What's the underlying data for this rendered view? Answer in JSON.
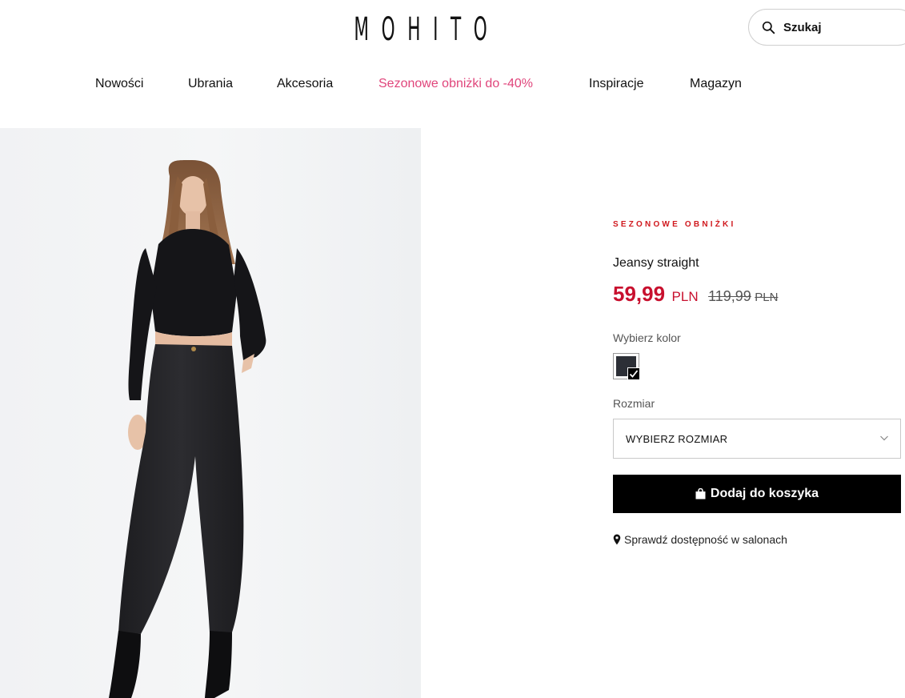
{
  "header": {
    "logo": "MOHITO",
    "search": {
      "placeholder": "Szukaj",
      "icon": "search-icon"
    }
  },
  "nav": {
    "items": [
      {
        "label": "Nowości"
      },
      {
        "label": "Ubrania"
      },
      {
        "label": "Akcesoria"
      },
      {
        "label": "Sezonowe obniżki do -40%",
        "highlight_color": "#e0457b"
      },
      {
        "label": "Inspiracje"
      },
      {
        "label": "Magazyn"
      }
    ]
  },
  "product": {
    "tag": "SEZONOWE OBNIŻKI",
    "name": "Jeansy straight",
    "price_now": "59,99",
    "currency_now": "PLN",
    "price_old": "119,99",
    "currency_old": "PLN",
    "color_label": "Wybierz kolor",
    "selected_color": "#2c2f36",
    "size_label": "Rozmiar",
    "size_select_value": "WYBIERZ ROZMIAR",
    "add_to_cart_label": "Dodaj do koszyka",
    "availability_label": "Sprawdź dostępność w salonach"
  },
  "colors": {
    "sale_red": "#c8102e",
    "nav_sale_pink": "#e0457b",
    "button_black": "#000000"
  }
}
